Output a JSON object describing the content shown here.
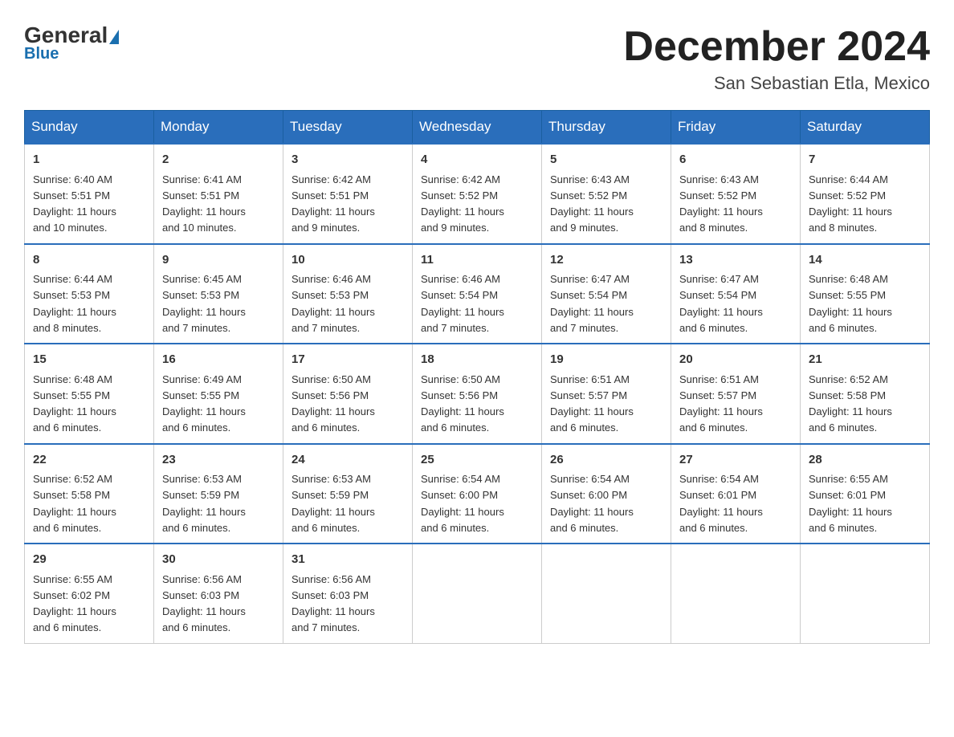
{
  "header": {
    "logo_main": "General",
    "logo_sub": "Blue",
    "month_title": "December 2024",
    "location": "San Sebastian Etla, Mexico"
  },
  "weekdays": [
    "Sunday",
    "Monday",
    "Tuesday",
    "Wednesday",
    "Thursday",
    "Friday",
    "Saturday"
  ],
  "weeks": [
    [
      {
        "day": "1",
        "sunrise": "6:40 AM",
        "sunset": "5:51 PM",
        "daylight": "11 hours and 10 minutes."
      },
      {
        "day": "2",
        "sunrise": "6:41 AM",
        "sunset": "5:51 PM",
        "daylight": "11 hours and 10 minutes."
      },
      {
        "day": "3",
        "sunrise": "6:42 AM",
        "sunset": "5:51 PM",
        "daylight": "11 hours and 9 minutes."
      },
      {
        "day": "4",
        "sunrise": "6:42 AM",
        "sunset": "5:52 PM",
        "daylight": "11 hours and 9 minutes."
      },
      {
        "day": "5",
        "sunrise": "6:43 AM",
        "sunset": "5:52 PM",
        "daylight": "11 hours and 9 minutes."
      },
      {
        "day": "6",
        "sunrise": "6:43 AM",
        "sunset": "5:52 PM",
        "daylight": "11 hours and 8 minutes."
      },
      {
        "day": "7",
        "sunrise": "6:44 AM",
        "sunset": "5:52 PM",
        "daylight": "11 hours and 8 minutes."
      }
    ],
    [
      {
        "day": "8",
        "sunrise": "6:44 AM",
        "sunset": "5:53 PM",
        "daylight": "11 hours and 8 minutes."
      },
      {
        "day": "9",
        "sunrise": "6:45 AM",
        "sunset": "5:53 PM",
        "daylight": "11 hours and 7 minutes."
      },
      {
        "day": "10",
        "sunrise": "6:46 AM",
        "sunset": "5:53 PM",
        "daylight": "11 hours and 7 minutes."
      },
      {
        "day": "11",
        "sunrise": "6:46 AM",
        "sunset": "5:54 PM",
        "daylight": "11 hours and 7 minutes."
      },
      {
        "day": "12",
        "sunrise": "6:47 AM",
        "sunset": "5:54 PM",
        "daylight": "11 hours and 7 minutes."
      },
      {
        "day": "13",
        "sunrise": "6:47 AM",
        "sunset": "5:54 PM",
        "daylight": "11 hours and 6 minutes."
      },
      {
        "day": "14",
        "sunrise": "6:48 AM",
        "sunset": "5:55 PM",
        "daylight": "11 hours and 6 minutes."
      }
    ],
    [
      {
        "day": "15",
        "sunrise": "6:48 AM",
        "sunset": "5:55 PM",
        "daylight": "11 hours and 6 minutes."
      },
      {
        "day": "16",
        "sunrise": "6:49 AM",
        "sunset": "5:55 PM",
        "daylight": "11 hours and 6 minutes."
      },
      {
        "day": "17",
        "sunrise": "6:50 AM",
        "sunset": "5:56 PM",
        "daylight": "11 hours and 6 minutes."
      },
      {
        "day": "18",
        "sunrise": "6:50 AM",
        "sunset": "5:56 PM",
        "daylight": "11 hours and 6 minutes."
      },
      {
        "day": "19",
        "sunrise": "6:51 AM",
        "sunset": "5:57 PM",
        "daylight": "11 hours and 6 minutes."
      },
      {
        "day": "20",
        "sunrise": "6:51 AM",
        "sunset": "5:57 PM",
        "daylight": "11 hours and 6 minutes."
      },
      {
        "day": "21",
        "sunrise": "6:52 AM",
        "sunset": "5:58 PM",
        "daylight": "11 hours and 6 minutes."
      }
    ],
    [
      {
        "day": "22",
        "sunrise": "6:52 AM",
        "sunset": "5:58 PM",
        "daylight": "11 hours and 6 minutes."
      },
      {
        "day": "23",
        "sunrise": "6:53 AM",
        "sunset": "5:59 PM",
        "daylight": "11 hours and 6 minutes."
      },
      {
        "day": "24",
        "sunrise": "6:53 AM",
        "sunset": "5:59 PM",
        "daylight": "11 hours and 6 minutes."
      },
      {
        "day": "25",
        "sunrise": "6:54 AM",
        "sunset": "6:00 PM",
        "daylight": "11 hours and 6 minutes."
      },
      {
        "day": "26",
        "sunrise": "6:54 AM",
        "sunset": "6:00 PM",
        "daylight": "11 hours and 6 minutes."
      },
      {
        "day": "27",
        "sunrise": "6:54 AM",
        "sunset": "6:01 PM",
        "daylight": "11 hours and 6 minutes."
      },
      {
        "day": "28",
        "sunrise": "6:55 AM",
        "sunset": "6:01 PM",
        "daylight": "11 hours and 6 minutes."
      }
    ],
    [
      {
        "day": "29",
        "sunrise": "6:55 AM",
        "sunset": "6:02 PM",
        "daylight": "11 hours and 6 minutes."
      },
      {
        "day": "30",
        "sunrise": "6:56 AM",
        "sunset": "6:03 PM",
        "daylight": "11 hours and 6 minutes."
      },
      {
        "day": "31",
        "sunrise": "6:56 AM",
        "sunset": "6:03 PM",
        "daylight": "11 hours and 7 minutes."
      },
      null,
      null,
      null,
      null
    ]
  ],
  "labels": {
    "sunrise": "Sunrise:",
    "sunset": "Sunset:",
    "daylight": "Daylight:"
  }
}
